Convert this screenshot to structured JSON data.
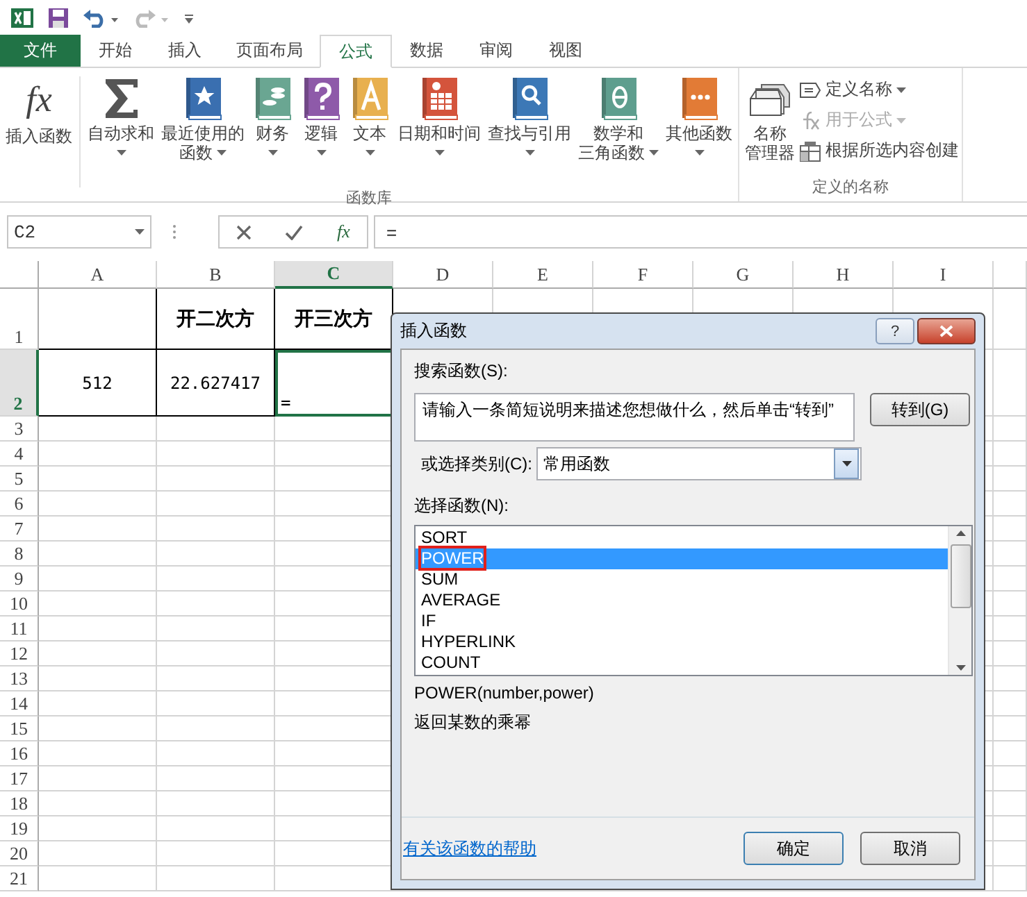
{
  "quick_access": [
    {
      "kind": "excel",
      "disabled": false
    },
    {
      "kind": "save",
      "disabled": false
    },
    {
      "kind": "undo",
      "disabled": false
    },
    {
      "kind": "redo",
      "disabled": true
    },
    {
      "kind": "customize",
      "disabled": false
    }
  ],
  "tabs": [
    {
      "label": "文件",
      "kind": "file",
      "selected": false
    },
    {
      "label": "开始",
      "kind": "tab",
      "selected": false
    },
    {
      "label": "插入",
      "kind": "tab",
      "selected": false
    },
    {
      "label": "页面布局",
      "kind": "tab",
      "selected": false
    },
    {
      "label": "公式",
      "kind": "tab",
      "selected": true
    },
    {
      "label": "数据",
      "kind": "tab",
      "selected": false
    },
    {
      "label": "审阅",
      "kind": "tab",
      "selected": false
    },
    {
      "label": "视图",
      "kind": "tab",
      "selected": false
    }
  ],
  "ribbon": {
    "groups": [
      {
        "label": "函数库",
        "buttons": [
          {
            "kind": "fx",
            "glyph": "fx",
            "lines": [
              "插入函数"
            ],
            "dropdown": false
          },
          {
            "kind": "sigma",
            "lines": [
              "自动求和"
            ],
            "dropdown": true
          },
          {
            "kind": "star",
            "lines": [
              "最近使用的",
              "函数"
            ],
            "dropdown": true
          },
          {
            "kind": "coins",
            "lines": [
              "财务"
            ],
            "dropdown": true
          },
          {
            "kind": "question",
            "lines": [
              "逻辑"
            ],
            "dropdown": true
          },
          {
            "kind": "letter",
            "lines": [
              "文本"
            ],
            "dropdown": true
          },
          {
            "kind": "calendar",
            "lines": [
              "日期和时间"
            ],
            "dropdown": true
          },
          {
            "kind": "search",
            "lines": [
              "查找与引用"
            ],
            "dropdown": true
          },
          {
            "kind": "theta",
            "lines": [
              "数学和",
              "三角函数"
            ],
            "dropdown": true
          },
          {
            "kind": "dots",
            "lines": [
              "其他函数"
            ],
            "dropdown": true
          }
        ]
      },
      {
        "label": "定义的名称",
        "buttons": [
          {
            "kind": "names",
            "lines": [
              "名称",
              "管理器"
            ],
            "dropdown": false
          }
        ],
        "small_buttons": [
          {
            "kind": "tag",
            "label": "定义名称",
            "dropdown": true,
            "disabled": false
          },
          {
            "kind": "formula",
            "label": "用于公式",
            "dropdown": true,
            "disabled": true
          },
          {
            "kind": "table",
            "label": "根据所选内容创建",
            "dropdown": false,
            "disabled": false
          }
        ]
      }
    ]
  },
  "formula_bar": {
    "name_box": "C2",
    "insert_function_glyph": "fx",
    "formula": "="
  },
  "sheet": {
    "columns": [
      {
        "label": "A",
        "selected": false
      },
      {
        "label": "B",
        "selected": false
      },
      {
        "label": "C",
        "selected": true
      },
      {
        "label": "D",
        "selected": false
      },
      {
        "label": "E",
        "selected": false
      },
      {
        "label": "F",
        "selected": false
      },
      {
        "label": "G",
        "selected": false
      },
      {
        "label": "H",
        "selected": false
      },
      {
        "label": "I",
        "selected": false
      }
    ],
    "rows": [
      {
        "number": "1",
        "selected": false,
        "cells": [
          {
            "bordered": true,
            "active": false
          },
          {
            "text": "开二次方",
            "bold": true,
            "bordered": true,
            "active": false
          },
          {
            "text": "开三次方",
            "bold": true,
            "bordered": true,
            "active": false
          }
        ]
      },
      {
        "number": "2",
        "selected": true,
        "cells": [
          {
            "text": "512",
            "bold": false,
            "bordered": true,
            "active": false
          },
          {
            "text": "22.627417",
            "bold": false,
            "bordered": true,
            "active": false
          },
          {
            "text": "=",
            "bold": false,
            "bordered": true,
            "active": true
          }
        ]
      },
      {
        "number": "3",
        "selected": false
      },
      {
        "number": "4",
        "selected": false
      },
      {
        "number": "5",
        "selected": false
      },
      {
        "number": "6",
        "selected": false
      },
      {
        "number": "7",
        "selected": false
      },
      {
        "number": "8",
        "selected": false
      },
      {
        "number": "9",
        "selected": false
      },
      {
        "number": "10",
        "selected": false
      },
      {
        "number": "11",
        "selected": false
      },
      {
        "number": "12",
        "selected": false
      },
      {
        "number": "13",
        "selected": false
      },
      {
        "number": "14",
        "selected": false
      },
      {
        "number": "15",
        "selected": false
      },
      {
        "number": "16",
        "selected": false
      },
      {
        "number": "17",
        "selected": false
      },
      {
        "number": "18",
        "selected": false
      },
      {
        "number": "19",
        "selected": false
      },
      {
        "number": "20",
        "selected": false
      },
      {
        "number": "21",
        "selected": false
      }
    ]
  },
  "dialog": {
    "title": "插入函数",
    "help_glyph": "?",
    "search_label": "搜索函数(S):",
    "search_value": "请输入一条简短说明来描述您想做什么，然后单击“转到”",
    "go_button": "转到(G)",
    "category_label": "或选择类别(C):",
    "category_value": "常用函数",
    "list_label": "选择函数(N):",
    "functions": [
      {
        "label": "SORT",
        "selected": false,
        "annotated": false
      },
      {
        "label": "POWER",
        "selected": true,
        "annotated": true
      },
      {
        "label": "SUM",
        "selected": false,
        "annotated": false
      },
      {
        "label": "AVERAGE",
        "selected": false,
        "annotated": false
      },
      {
        "label": "IF",
        "selected": false,
        "annotated": false
      },
      {
        "label": "HYPERLINK",
        "selected": false,
        "annotated": false
      },
      {
        "label": "COUNT",
        "selected": false,
        "annotated": false
      }
    ],
    "signature": "POWER(number,power)",
    "description": "返回某数的乘幂",
    "help_link": "有关该函数的帮助",
    "ok_button": "确定",
    "cancel_button": "取消"
  }
}
